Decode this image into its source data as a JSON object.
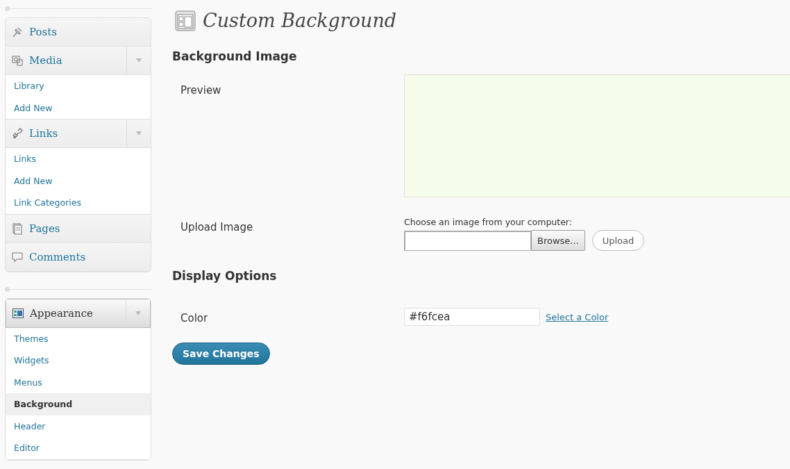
{
  "menu_groups": [
    {
      "items": [
        {
          "label": "Posts",
          "current": false
        },
        {
          "label": "Media",
          "current": false,
          "expanded": true,
          "children": [
            {
              "label": "Library",
              "selected": false
            },
            {
              "label": "Add New",
              "selected": false
            }
          ]
        },
        {
          "label": "Links",
          "current": false,
          "expanded": true,
          "children": [
            {
              "label": "Links",
              "selected": false
            },
            {
              "label": "Add New",
              "selected": false
            },
            {
              "label": "Link Categories",
              "selected": false
            }
          ]
        },
        {
          "label": "Pages",
          "current": false
        },
        {
          "label": "Comments",
          "current": false
        }
      ]
    },
    {
      "items": [
        {
          "label": "Appearance",
          "current": true,
          "expanded": true,
          "children": [
            {
              "label": "Themes",
              "selected": false
            },
            {
              "label": "Widgets",
              "selected": false
            },
            {
              "label": "Menus",
              "selected": false
            },
            {
              "label": "Background",
              "selected": true
            },
            {
              "label": "Header",
              "selected": false
            },
            {
              "label": "Editor",
              "selected": false
            }
          ]
        }
      ]
    }
  ],
  "page_title": "Custom Background",
  "sections": [
    {
      "heading": "Background Image",
      "rows": [
        {
          "kind": "preview",
          "label": "Preview"
        },
        {
          "kind": "upload",
          "label": "Upload Image",
          "hint": "Choose an image from your computer:",
          "browse_button": "Browse...",
          "upload_button": "Upload"
        }
      ]
    },
    {
      "heading": "Display Options",
      "rows": [
        {
          "kind": "color",
          "label": "Color",
          "value": "#f6fcea",
          "link": "Select a Color"
        }
      ]
    }
  ],
  "save_button": "Save Changes"
}
